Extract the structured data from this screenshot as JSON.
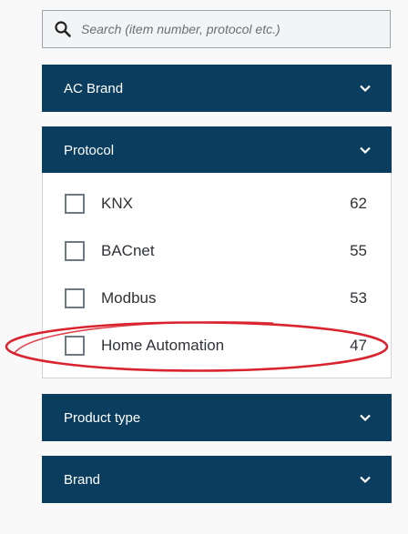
{
  "search": {
    "placeholder": "Search (item number, protocol etc.)",
    "value": ""
  },
  "filters": [
    {
      "title": "AC Brand",
      "expanded": false
    },
    {
      "title": "Protocol",
      "expanded": true,
      "options": [
        {
          "label": "KNX",
          "count": "62",
          "checked": false
        },
        {
          "label": "BACnet",
          "count": "55",
          "checked": false
        },
        {
          "label": "Modbus",
          "count": "53",
          "checked": false
        },
        {
          "label": "Home Automation",
          "count": "47",
          "checked": false
        }
      ]
    },
    {
      "title": "Product type",
      "expanded": false
    },
    {
      "title": "Brand",
      "expanded": false
    }
  ],
  "icons": {
    "search": "search-icon",
    "chevron": "chevron-down-icon"
  },
  "colors": {
    "header_bg": "#0a3d5e",
    "header_text": "#ffffff",
    "annotation": "#d9232e"
  },
  "annotation": {
    "type": "ellipse",
    "target": "Home Automation"
  }
}
